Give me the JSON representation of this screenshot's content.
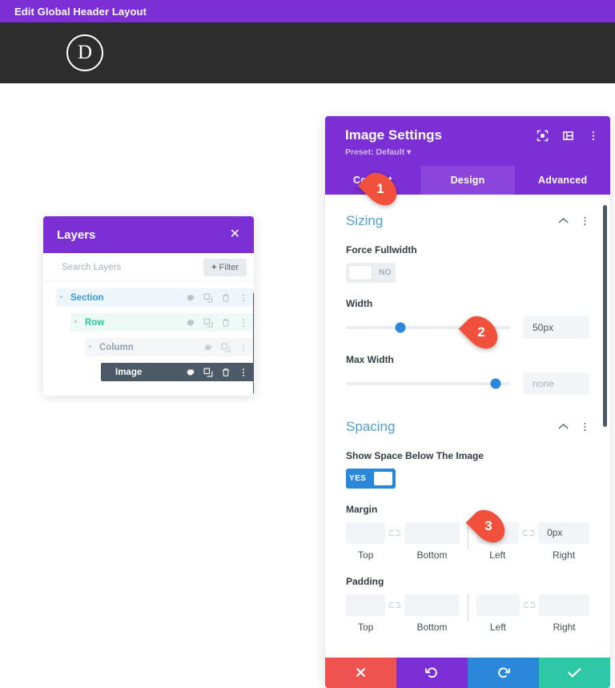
{
  "admin_bar": {
    "title": "Edit Global Header Layout"
  },
  "site_header": {
    "logo_letter": "D"
  },
  "layers_panel": {
    "title": "Layers",
    "close_label": "✕",
    "search_placeholder": "Search Layers",
    "search_value": "",
    "filter_label": "Filter",
    "filter_plus": "+",
    "rows": [
      {
        "label": "Section",
        "arrow": "▾"
      },
      {
        "label": "Row",
        "arrow": "▾"
      },
      {
        "label": "Column",
        "arrow": "▾"
      },
      {
        "label": "Image",
        "arrow": ""
      }
    ]
  },
  "settings": {
    "title": "Image Settings",
    "preset": "Preset: Default ▾",
    "tabs": [
      {
        "label": "Content",
        "active": false
      },
      {
        "label": "Design",
        "active": true
      },
      {
        "label": "Advanced",
        "active": false
      }
    ],
    "sizing": {
      "section_title": "Sizing",
      "force_fullwidth": {
        "label": "Force Fullwidth",
        "state": "NO"
      },
      "width": {
        "label": "Width",
        "value": "50px",
        "handle_percent": 33
      },
      "max_width": {
        "label": "Max Width",
        "value": "none",
        "is_placeholder": true,
        "handle_percent": 91
      }
    },
    "spacing": {
      "section_title": "Spacing",
      "show_space_below": {
        "label": "Show Space Below The Image",
        "state": "YES"
      },
      "margin": {
        "label": "Margin",
        "values": [
          "",
          "",
          "",
          "0px"
        ],
        "captions": [
          "Top",
          "Bottom",
          "Left",
          "Right"
        ]
      },
      "padding": {
        "label": "Padding",
        "values": [
          "",
          "",
          "",
          ""
        ],
        "captions": [
          "Top",
          "Bottom",
          "Left",
          "Right"
        ]
      }
    },
    "footer": {
      "close_label": "✕",
      "undo_label": "↺",
      "redo_label": "↻",
      "save_label": "✓"
    }
  },
  "markers": [
    {
      "number": "1"
    },
    {
      "number": "2"
    },
    {
      "number": "3"
    }
  ],
  "colors": {
    "purple": "#7b2fd4",
    "purple_active": "#8b45dd",
    "blue": "#2b87da",
    "green": "#2ec8a6",
    "red": "#ef5350",
    "marker_red": "#f0503c",
    "section_blue": "#2d9fd9",
    "row_green": "#2dc8a0",
    "dark_slate": "#4c5967",
    "header_dark": "#2d2d2d"
  }
}
